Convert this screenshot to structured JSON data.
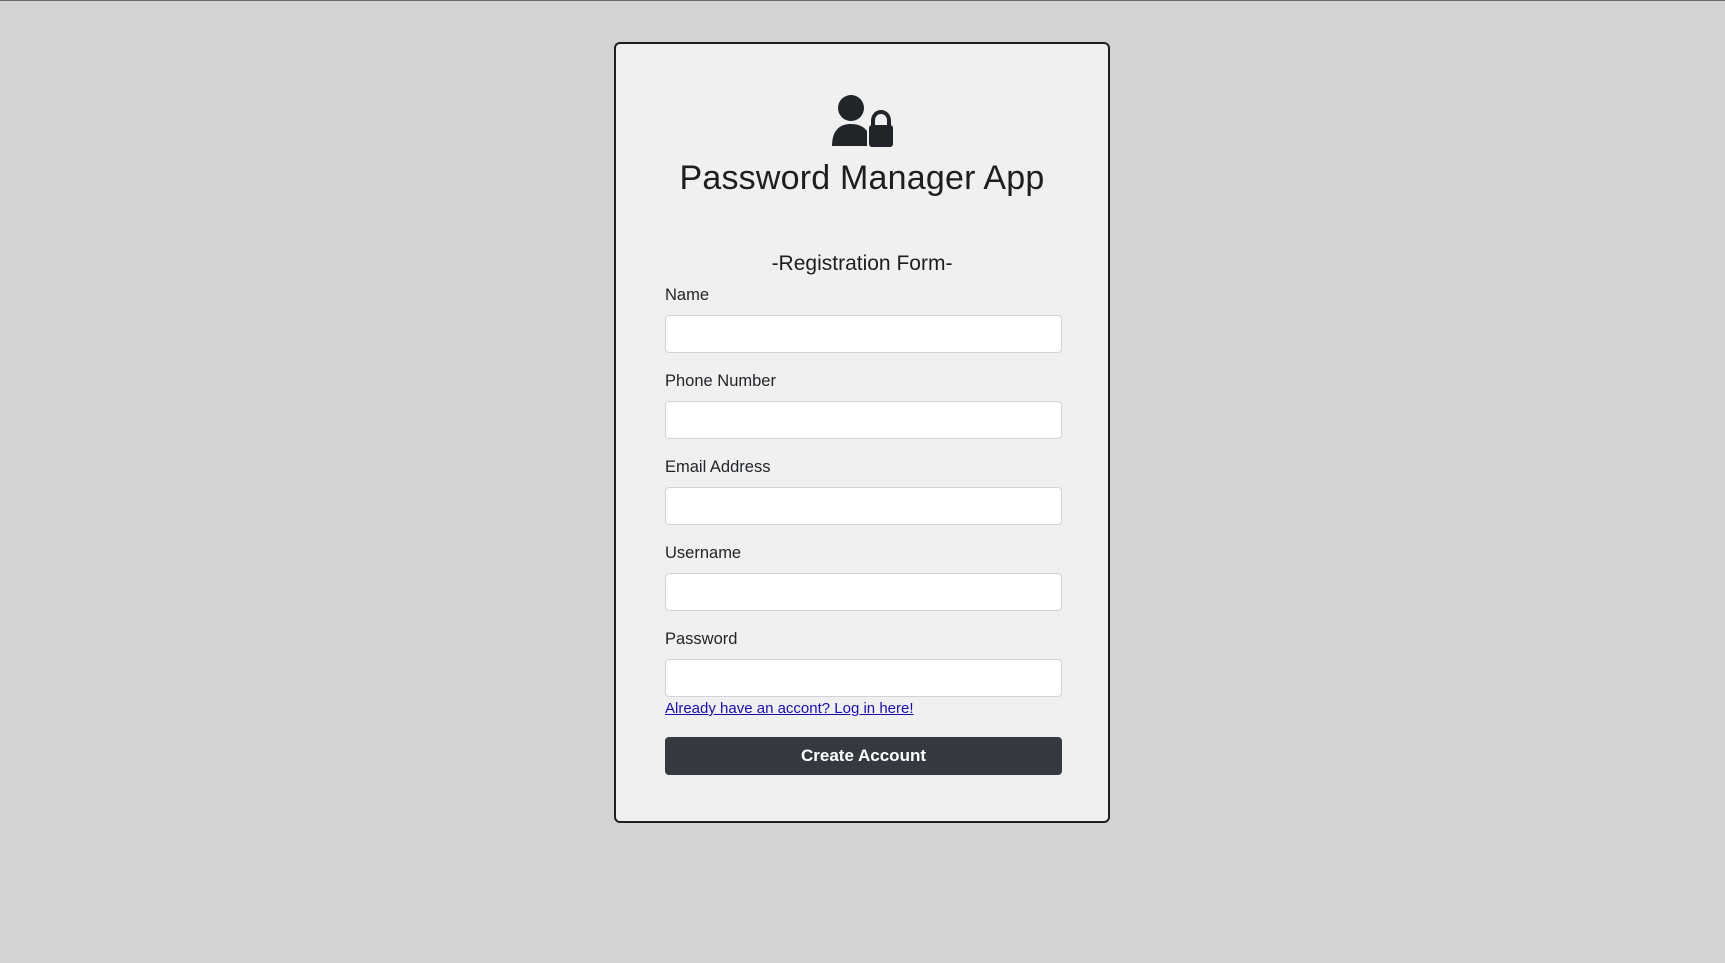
{
  "app": {
    "title": "Password Manager App",
    "icon": "user-lock-icon"
  },
  "form": {
    "title": "-Registration Form-",
    "fields": [
      {
        "label": "Name",
        "value": "",
        "placeholder": ""
      },
      {
        "label": "Phone Number",
        "value": "",
        "placeholder": ""
      },
      {
        "label": "Email Address",
        "value": "",
        "placeholder": ""
      },
      {
        "label": "Username",
        "value": "",
        "placeholder": ""
      },
      {
        "label": "Password",
        "value": "",
        "placeholder": ""
      }
    ],
    "login_link": "Already have an accont? Log in here!",
    "submit_label": "Create Account"
  },
  "colors": {
    "page_background": "#d3d3d3",
    "card_background": "#f0f0f0",
    "button_background": "#343a40",
    "link": "#1a0dab"
  }
}
